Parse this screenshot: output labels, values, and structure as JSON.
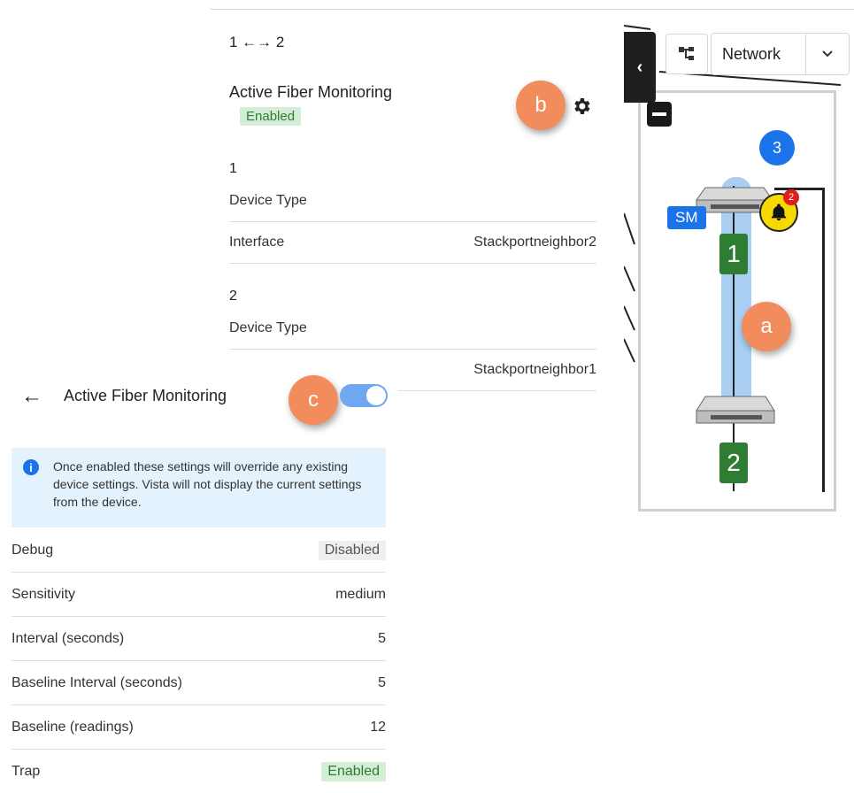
{
  "details": {
    "link_title": "1 ←→ 2",
    "afm_title": "Active Fiber Monitoring",
    "afm_status": "Enabled",
    "section1": {
      "label": "1",
      "device_type_label": "Device Type",
      "device_type_value": "",
      "interface_label": "Interface",
      "interface_value": "Stackportneighbor2"
    },
    "section2": {
      "label": "2",
      "device_type_label": "Device Type",
      "device_type_value": "",
      "interface_value": "Stackportneighbor1"
    }
  },
  "callouts": {
    "a": "a",
    "b": "b",
    "c": "c"
  },
  "map": {
    "view_select": "Network",
    "site_number": "3",
    "sm_label": "SM",
    "alarm_count": "2",
    "node1": "1",
    "node2": "2"
  },
  "settings": {
    "title": "Active Fiber Monitoring",
    "toggle_on": true,
    "info_text": "Once enabled these settings will override any existing device settings. Vista will not display the current settings from the device.",
    "rows": [
      {
        "label": "Debug",
        "value": "Disabled"
      },
      {
        "label": "Sensitivity",
        "value": "medium"
      },
      {
        "label": "Interval (seconds)",
        "value": "5"
      },
      {
        "label": "Baseline Interval (seconds)",
        "value": "5"
      },
      {
        "label": "Baseline (readings)",
        "value": "12"
      },
      {
        "label": "Trap",
        "value": "Enabled"
      }
    ]
  },
  "colors": {
    "accent": "#1a73e8",
    "callout": "#f28c5d",
    "enabled_bg": "#d4edd6",
    "enabled_fg": "#2e7d32",
    "link_highlight": "#a9cff2"
  },
  "icons": {
    "gear": "gear-icon",
    "back": "arrow-left-icon",
    "info": "info-icon",
    "topology": "topology-icon",
    "chevron_left": "chevron-left-icon",
    "chevron_down": "chevron-down-icon",
    "bell": "bell-icon",
    "switch": "switch-icon"
  }
}
